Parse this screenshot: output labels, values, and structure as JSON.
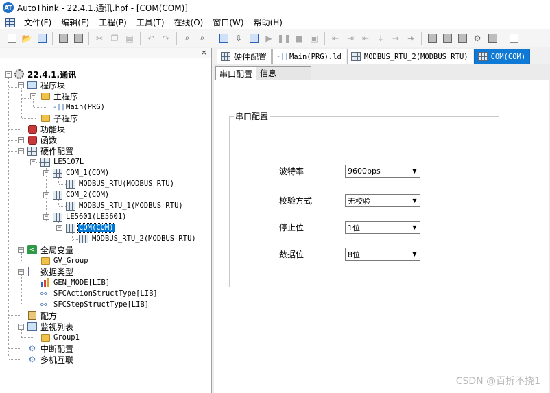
{
  "window": {
    "app_icon_text": "AT",
    "title": "AutoThink - 22.4.1.通讯.hpf - [COM(COM)]"
  },
  "menu": [
    "文件(F)",
    "编辑(E)",
    "工程(P)",
    "工具(T)",
    "在线(O)",
    "窗口(W)",
    "帮助(H)"
  ],
  "tree": {
    "close_glyph": "×",
    "root": "22.4.1.通讯",
    "program_block": "程序块",
    "main_program": "主程序",
    "main_prg": "Main(PRG)",
    "sub_program": "子程序",
    "function_block": "功能块",
    "function": "函数",
    "hardware_config": "硬件配置",
    "le5107l": "LE5107L",
    "com1": "COM_1(COM)",
    "modbus_rtu": "MODBUS_RTU(MODBUS RTU)",
    "com2": "COM_2(COM)",
    "modbus_rtu_1": "MODBUS_RTU_1(MODBUS RTU)",
    "le5601": "LE5601(LE5601)",
    "com": "COM(COM)",
    "modbus_rtu_2": "MODBUS_RTU_2(MODBUS RTU)",
    "global_vars": "全局变量",
    "gv_group": "GV_Group",
    "data_types": "数据类型",
    "gen_mode": "GEN_MODE[LIB]",
    "sfc_action": "SFCActionStructType[LIB]",
    "sfc_step": "SFCStepStructType[LIB]",
    "recipe": "配方",
    "watch_list": "监视列表",
    "group1": "Group1",
    "interrupt_config": "中断配置",
    "multi_machine": "多机互联"
  },
  "doc_tabs": [
    "硬件配置",
    "Main(PRG).ld",
    "MODBUS_RTU_2(MODBUS RTU)",
    "COM(COM)"
  ],
  "inner_tabs": [
    "串口配置",
    "信息"
  ],
  "serial_group": {
    "legend": "串口配置",
    "baud_label": "波特率",
    "baud_value": "9600bps",
    "parity_label": "校验方式",
    "parity_value": "无校验",
    "stop_label": "停止位",
    "stop_value": "1位",
    "data_label": "数据位",
    "data_value": "8位"
  },
  "watermark": "CSDN @百折不挠1",
  "colors": {
    "active_tab": "#0e7ad6",
    "selection": "#0078d7"
  }
}
